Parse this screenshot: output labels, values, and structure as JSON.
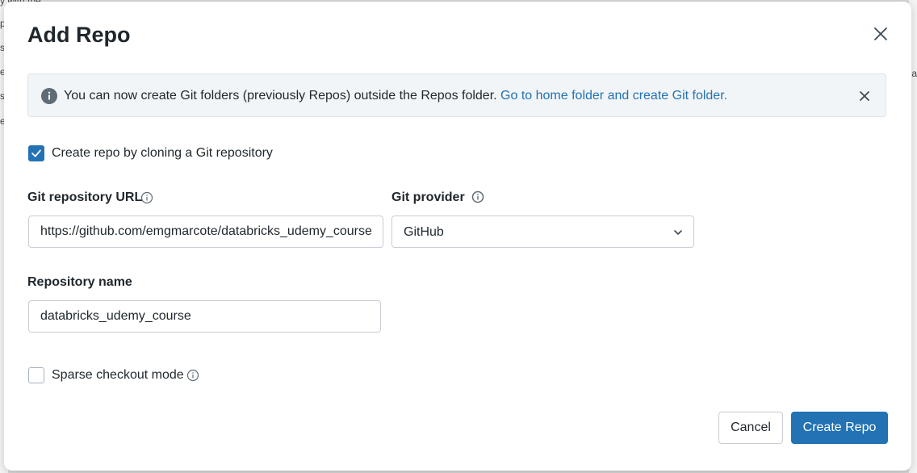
{
  "background": {
    "fragments": [
      "y with the",
      "p",
      "s",
      "e",
      "s",
      "e"
    ],
    "right_fragment": "a"
  },
  "dialog": {
    "title": "Add Repo",
    "banner": {
      "text": "You can now create Git folders (previously Repos) outside the Repos folder.",
      "link": "Go to home folder and create Git folder."
    },
    "clone_checkbox": {
      "label": "Create repo by cloning a Git repository",
      "checked": true
    },
    "git_url": {
      "label": "Git repository URL",
      "value": "https://github.com/emgmarcote/databricks_udemy_course"
    },
    "git_provider": {
      "label": "Git provider",
      "selected": "GitHub"
    },
    "repo_name": {
      "label": "Repository name",
      "value": "databricks_udemy_course"
    },
    "sparse_checkbox": {
      "label": "Sparse checkout mode",
      "checked": false
    },
    "buttons": {
      "cancel": "Cancel",
      "create": "Create Repo"
    }
  },
  "colors": {
    "primary": "#2272b4",
    "banner_bg": "#f2f5f7",
    "text": "#1f272d",
    "border": "#c7cdd2"
  },
  "icons": [
    "close-icon",
    "info-icon",
    "check-icon",
    "help-circle-icon",
    "chevron-down-icon"
  ]
}
